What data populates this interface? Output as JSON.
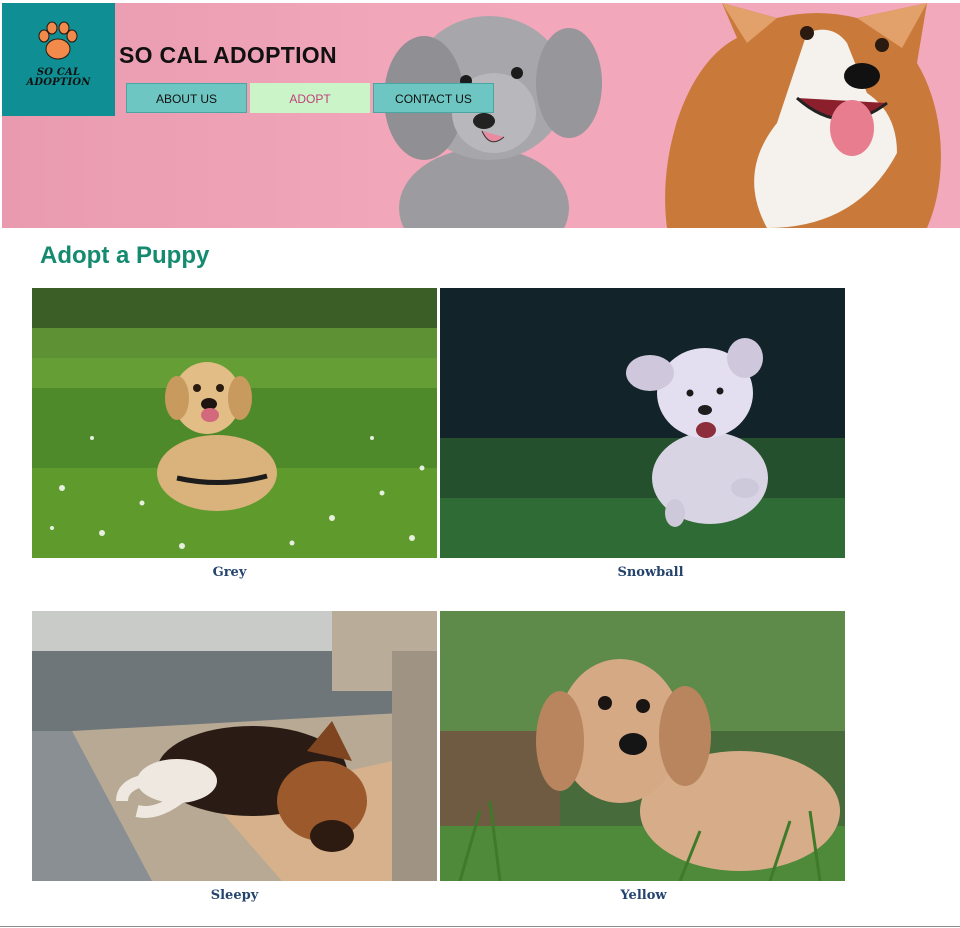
{
  "header": {
    "logo_line1": "SO CAL",
    "logo_line2": "ADOPTION",
    "site_title": "SO CAL ADOPTION",
    "nav": [
      {
        "label": "ABOUT US"
      },
      {
        "label": "ADOPT"
      },
      {
        "label": "CONTACT US"
      }
    ]
  },
  "main": {
    "title": "Adopt a Puppy",
    "puppies": [
      {
        "name": "Grey"
      },
      {
        "name": "Snowball"
      },
      {
        "name": "Sleepy"
      },
      {
        "name": "Yellow"
      }
    ]
  },
  "colors": {
    "logo_bg": "#0f8e93",
    "banner_bg": "#f1a6b9",
    "nav_bg": "#6ec6c2",
    "nav_active_bg": "#cbf5c9",
    "nav_active_text": "#c0407a",
    "title_green": "#148a6f",
    "caption_blue": "#24436d"
  }
}
